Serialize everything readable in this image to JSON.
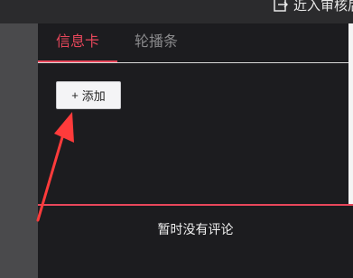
{
  "topbar": {
    "hint_text": "近入审核后",
    "hint_icon": "exit-icon"
  },
  "tabs": [
    {
      "label": "信息卡",
      "active": true
    },
    {
      "label": "轮播条",
      "active": false
    }
  ],
  "add_button": {
    "icon": "plus-icon",
    "label": "添加"
  },
  "comments": {
    "empty_text": "暂时没有评论"
  },
  "annotation": {
    "icon": "red-arrow-icon",
    "color": "#ff3b3b"
  },
  "colors": {
    "accent": "#e8475b",
    "panel_bg": "#1c1c1f"
  }
}
